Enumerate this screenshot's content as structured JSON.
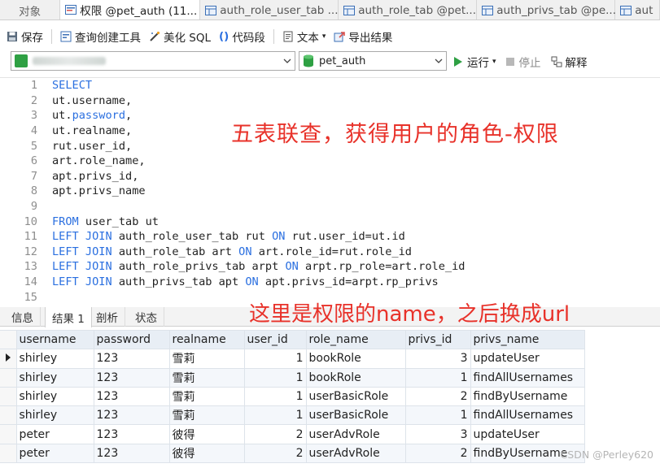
{
  "tabs": {
    "objects": "对象",
    "active": "权限 @pet_auth (11...",
    "t2": "auth_role_user_tab ...",
    "t3": "auth_role_tab @pet...",
    "t4": "auth_privs_tab @pe...",
    "t5": "aut"
  },
  "toolbar": {
    "save": "保存",
    "query_builder": "查询创建工具",
    "beautify": "美化 SQL",
    "snippet": "代码段",
    "text": "文本",
    "export": "导出结果"
  },
  "selectors": {
    "database": "pet_auth",
    "run": "运行",
    "stop": "停止",
    "explain": "解释"
  },
  "editor": {
    "line_numbers": [
      "1",
      "2",
      "3",
      "4",
      "5",
      "6",
      "7",
      "8",
      "9",
      "10",
      "11",
      "12",
      "13",
      "14",
      "15"
    ],
    "l1_kw": "SELECT",
    "l2": "ut.username,",
    "l3a": "ut.",
    "l3b": "password",
    "l3c": ",",
    "l4": "ut.realname,",
    "l5": "rut.user_id,",
    "l6": "art.role_name,",
    "l7": "apt.privs_id,",
    "l8": "apt.privs_name",
    "l10_kw": "FROM",
    "l10": " user_tab ut",
    "join_kw": "LEFT JOIN",
    "on_kw": "ON",
    "l11a": " auth_role_user_tab rut ",
    "l11b": " rut.user_id=ut.id",
    "l12a": " auth_role_tab art ",
    "l12b": " art.role_id=rut.role_id",
    "l13a": " auth_role_privs_tab arpt ",
    "l13b": " arpt.rp_role=art.role_id",
    "l14a": " auth_privs_tab apt ",
    "l14b": " apt.privs_id=arpt.rp_privs"
  },
  "annotations": {
    "top": "五表联查，获得用户的角色-权限",
    "bottom": "这里是权限的name，之后换成url"
  },
  "result_tabs": {
    "info": "信息",
    "result1": "结果 1",
    "profile": "剖析",
    "status": "状态"
  },
  "grid": {
    "headers": [
      "username",
      "password",
      "realname",
      "user_id",
      "role_name",
      "privs_id",
      "privs_name"
    ],
    "rows": [
      [
        "shirley",
        "123",
        "雪莉",
        "1",
        "bookRole",
        "3",
        "updateUser"
      ],
      [
        "shirley",
        "123",
        "雪莉",
        "1",
        "bookRole",
        "1",
        "findAllUsernames"
      ],
      [
        "shirley",
        "123",
        "雪莉",
        "1",
        "userBasicRole",
        "2",
        "findByUsername"
      ],
      [
        "shirley",
        "123",
        "雪莉",
        "1",
        "userBasicRole",
        "1",
        "findAllUsernames"
      ],
      [
        "peter",
        "123",
        "彼得",
        "2",
        "userAdvRole",
        "3",
        "updateUser"
      ],
      [
        "peter",
        "123",
        "彼得",
        "2",
        "userAdvRole",
        "2",
        "findByUsername"
      ]
    ]
  },
  "watermark": "CSDN @Perley620",
  "colors": {
    "keyword": "#2a6fe0",
    "annotation": "#e8322a",
    "run": "#2ea043"
  }
}
